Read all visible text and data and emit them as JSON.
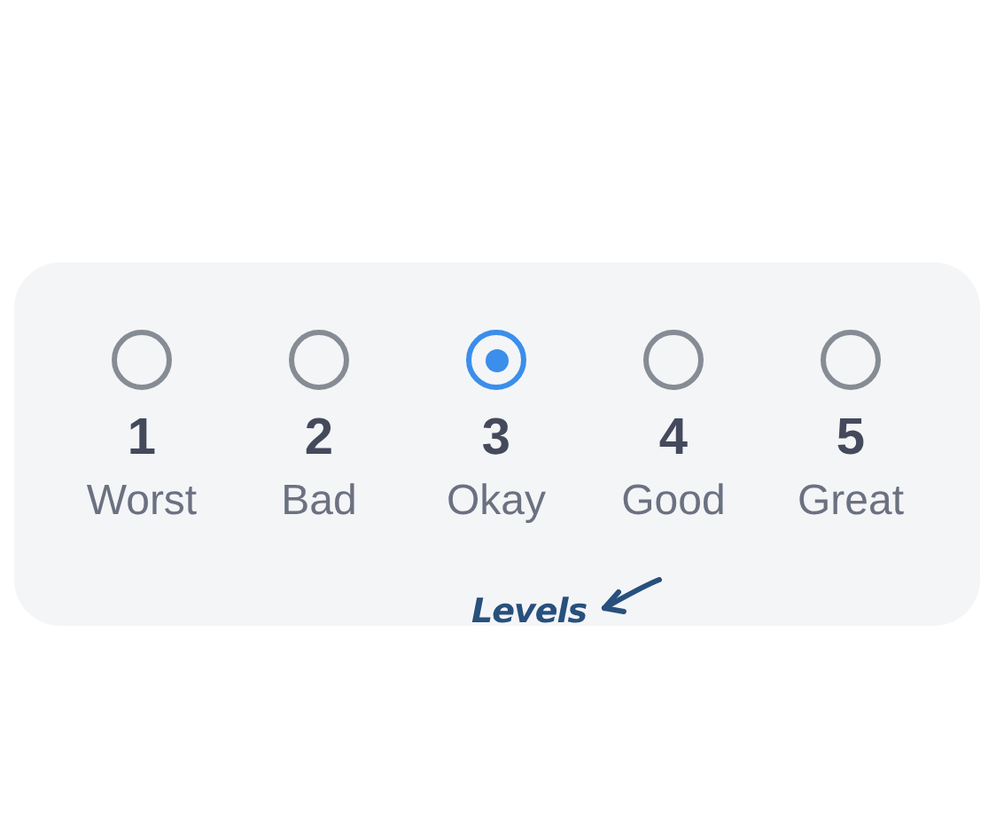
{
  "options": [
    {
      "number": "1",
      "label": "Worst",
      "selected": false
    },
    {
      "number": "2",
      "label": "Bad",
      "selected": false
    },
    {
      "number": "3",
      "label": "Okay",
      "selected": true
    },
    {
      "number": "4",
      "label": "Good",
      "selected": false
    },
    {
      "number": "5",
      "label": "Great",
      "selected": false
    }
  ],
  "annotation": {
    "text": "Levels"
  }
}
